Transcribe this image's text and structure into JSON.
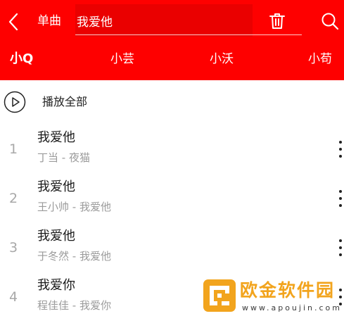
{
  "colors": {
    "header_bg": "#fe0000",
    "search_box_bg": "#ea0000",
    "divider": "#ffcccc",
    "title_text": "#1a1a1a",
    "subtitle_text": "#9b9b9b",
    "index_text": "#a8a8a8",
    "watermark_gold": "#f2a41d",
    "watermark_dark": "#3a3a3a"
  },
  "header": {
    "back_icon": "chevron-left-icon",
    "type_label": "单曲",
    "search": {
      "value": "我爱他",
      "placeholder": ""
    },
    "trash_icon": "trash-icon",
    "search_icon": "search-icon"
  },
  "tabs": [
    {
      "label": "小Q",
      "active": true
    },
    {
      "label": "小芸",
      "active": false
    },
    {
      "label": "小沃",
      "active": false
    },
    {
      "label": "小苟",
      "active": false
    }
  ],
  "play_all": {
    "icon": "play-icon",
    "label": "播放全部"
  },
  "songs": [
    {
      "index": "1",
      "title": "我爱他",
      "subtitle": "丁当 - 夜猫"
    },
    {
      "index": "2",
      "title": "我爱他",
      "subtitle": "王小帅 - 我爱他"
    },
    {
      "index": "3",
      "title": "我爱他",
      "subtitle": "于冬然 - 我爱他"
    },
    {
      "index": "4",
      "title": "我爱你",
      "subtitle": "程佳佳 - 我爱你"
    }
  ],
  "more_icon": "more-vertical-icon",
  "watermark": {
    "brand": "欧金软件园",
    "url": "www.apoujin.com"
  }
}
